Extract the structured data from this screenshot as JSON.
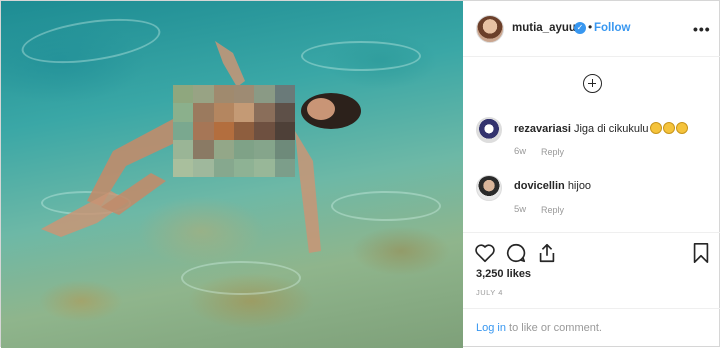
{
  "post": {
    "author": "mutia_ayuu",
    "verified": true,
    "separator": "•",
    "follow_label": "Follow",
    "more_label": "•••"
  },
  "comments": [
    {
      "user": "rezavariasi",
      "text": "Jiga di cikukulu",
      "emoji_count": 3,
      "time": "6w",
      "reply_label": "Reply"
    },
    {
      "user": "dovicellin",
      "text": "hijoo",
      "time": "5w",
      "reply_label": "Reply"
    }
  ],
  "actions": {
    "like_icon": "heart-icon",
    "comment_icon": "comment-icon",
    "share_icon": "share-icon",
    "save_icon": "bookmark-icon",
    "likes_text": "3,250 likes",
    "date_text": "JULY 4"
  },
  "footer": {
    "login_link": "Log in",
    "login_rest": " to like or comment."
  },
  "colors": {
    "link_blue": "#3897f0",
    "text_dark": "#262626",
    "text_muted": "#999999",
    "water": "#3aa7a6"
  }
}
